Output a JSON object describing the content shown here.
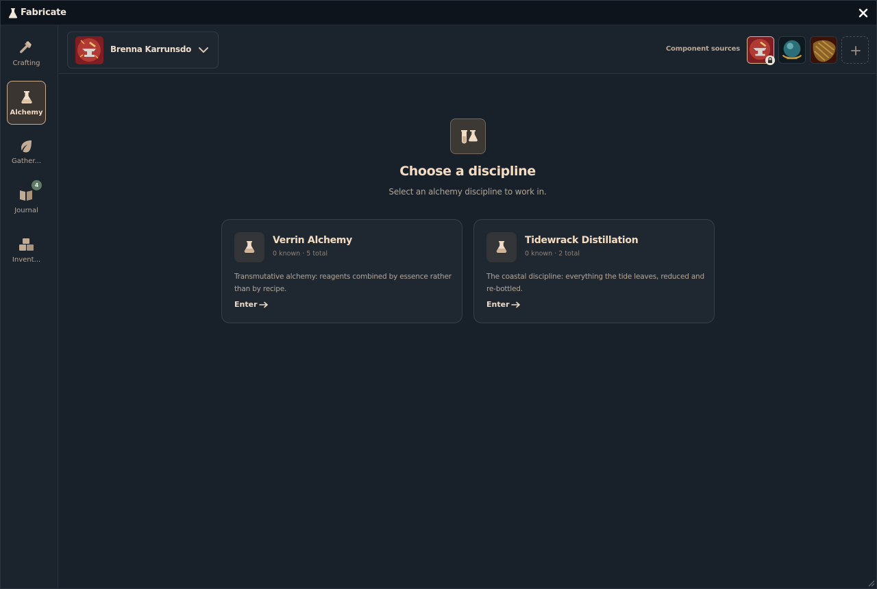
{
  "app": {
    "title": "Fabricate",
    "icon": "flask-icon",
    "close_icon": "close-icon"
  },
  "sidebar": {
    "items": [
      {
        "label": "Crafting",
        "icon": "hammer-icon",
        "active": false
      },
      {
        "label": "Alchemy",
        "icon": "flask-icon",
        "active": true
      },
      {
        "label": "Gather...",
        "icon": "leaf-icon",
        "active": false
      },
      {
        "label": "Journal",
        "icon": "book-icon",
        "active": false,
        "badge": "4"
      },
      {
        "label": "Invent...",
        "icon": "boxes-icon",
        "active": false
      }
    ]
  },
  "header": {
    "character": {
      "name": "Brenna Karrunsdottir",
      "icon": "anvil-portrait",
      "dropdown_icon": "chevron-down-icon"
    },
    "sources_label": "Component sources",
    "sources": [
      {
        "icon": "anvil-portrait",
        "locked": true
      },
      {
        "icon": "crystal-orb-portrait",
        "locked": false
      },
      {
        "icon": "fur-pelt-portrait",
        "locked": false
      }
    ],
    "add_icon": "plus-icon"
  },
  "main": {
    "hero_icon": "beakers-icon",
    "title": "Choose a discipline",
    "subtitle": "Select an alchemy discipline to work in.",
    "cards": [
      {
        "title": "Verrin Alchemy",
        "meta": "0 known · 5 total",
        "description": "Transmutative alchemy: reagents combined by essence rather than by recipe.",
        "action": "Enter",
        "icon": "flask-icon"
      },
      {
        "title": "Tidewrack Distillation",
        "meta": "0 known · 2 total",
        "description": "The coastal discipline: everything the tide leaves, reduced and re-bottled.",
        "action": "Enter",
        "icon": "flask-icon"
      }
    ]
  },
  "colors": {
    "accent": "#f4dcc3",
    "active_border": "#c9ad8f",
    "background": "#18212a",
    "badge": "#5e7a66"
  }
}
